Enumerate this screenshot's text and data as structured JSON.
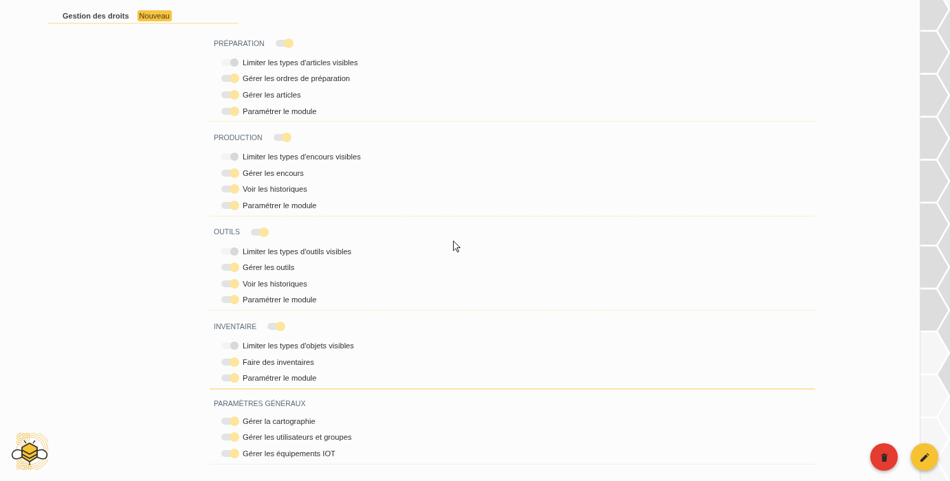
{
  "header": {
    "title": "Gestion des droits",
    "badge": "Nouveau"
  },
  "sections": [
    {
      "title": "PRÉPARATION",
      "on": true,
      "items": [
        {
          "label": "Limiter les types d'articles visibles",
          "on": false
        },
        {
          "label": "Gérer les ordres de préparation",
          "on": true
        },
        {
          "label": "Gérer les articles",
          "on": true
        },
        {
          "label": "Paramétrer le module",
          "on": true
        }
      ]
    },
    {
      "title": "PRODUCTION",
      "on": true,
      "items": [
        {
          "label": "Limiter les types d'encours visibles",
          "on": false
        },
        {
          "label": "Gérer les encours",
          "on": true
        },
        {
          "label": "Voir les historiques",
          "on": true
        },
        {
          "label": "Paramétrer le module",
          "on": true
        }
      ]
    },
    {
      "title": "OUTILS",
      "on": true,
      "items": [
        {
          "label": "Limiter les types d'outils visibles",
          "on": false
        },
        {
          "label": "Gérer les outils",
          "on": true
        },
        {
          "label": "Voir les historiques",
          "on": true
        },
        {
          "label": "Paramétrer le module",
          "on": true
        }
      ]
    },
    {
      "title": "INVENTAIRE",
      "on": true,
      "items": [
        {
          "label": "Limiter les types d'objets visibles",
          "on": false
        },
        {
          "label": "Faire des inventaires",
          "on": true
        },
        {
          "label": "Paramétrer le module",
          "on": true
        }
      ]
    },
    {
      "title": "PARAMÈTRES GÉNÉRAUX",
      "items": [
        {
          "label": "Gérer la cartographie",
          "on": true
        },
        {
          "label": "Gérer les utilisateurs et groupes",
          "on": true
        },
        {
          "label": "Gérer les équipements IOT",
          "on": true
        }
      ]
    }
  ],
  "actions": [
    {
      "kind": "delete"
    },
    {
      "kind": "edit"
    }
  ]
}
